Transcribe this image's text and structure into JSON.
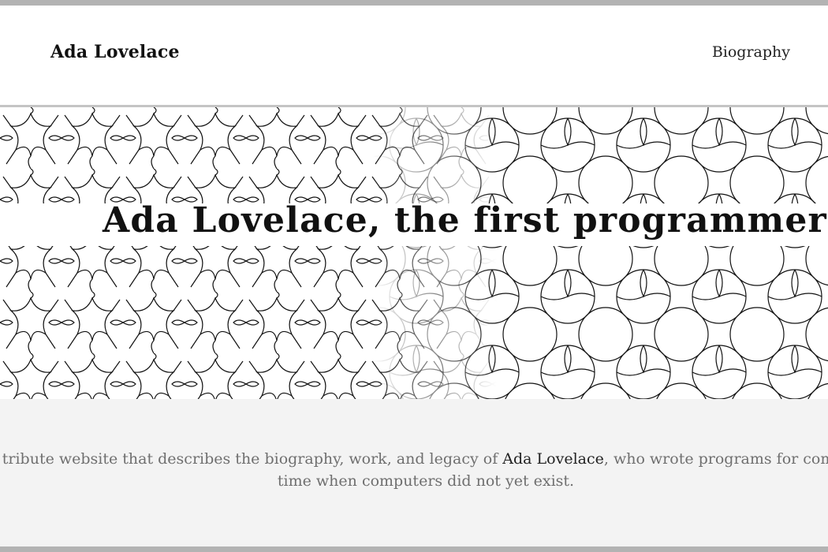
{
  "header": {
    "logo": "Ada Lovelace",
    "nav": [
      {
        "label": "Biography"
      }
    ]
  },
  "hero": {
    "title": "Ada Lovelace, the first programmer in history"
  },
  "intro": {
    "text_before": "This is a tribute website that describes the biography, work, and legacy of ",
    "highlight": "Ada Lovelace",
    "text_after": ", who wrote programs for computing at a time when computers did not yet exist."
  }
}
